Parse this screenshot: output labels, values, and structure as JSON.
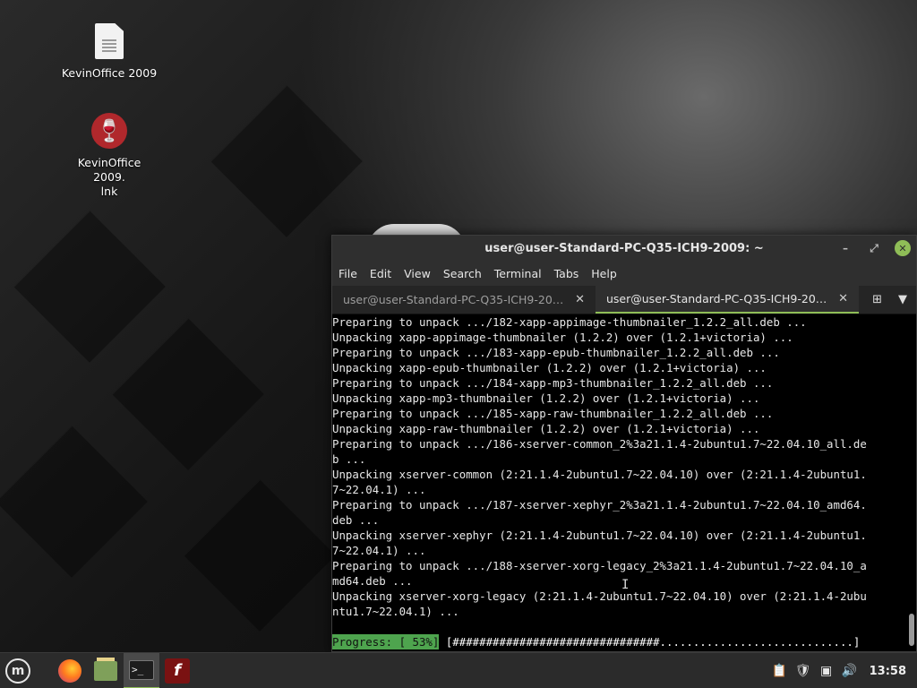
{
  "desktop": {
    "icons": [
      {
        "label": "KevinOffice 2009",
        "icon": "document-icon"
      },
      {
        "label": "KevinOffice 2009.\nlnk",
        "icon": "wine-icon"
      }
    ]
  },
  "terminal": {
    "title": "user@user-Standard-PC-Q35-ICH9-2009: ~",
    "menus": [
      "File",
      "Edit",
      "View",
      "Search",
      "Terminal",
      "Tabs",
      "Help"
    ],
    "tabs": [
      {
        "label": "user@user-Standard-PC-Q35-ICH9-2009: ~",
        "active": false
      },
      {
        "label": "user@user-Standard-PC-Q35-ICH9-2009: ~",
        "active": true
      }
    ],
    "lines": [
      "Preparing to unpack .../182-xapp-appimage-thumbnailer_1.2.2_all.deb ...",
      "Unpacking xapp-appimage-thumbnailer (1.2.2) over (1.2.1+victoria) ...",
      "Preparing to unpack .../183-xapp-epub-thumbnailer_1.2.2_all.deb ...",
      "Unpacking xapp-epub-thumbnailer (1.2.2) over (1.2.1+victoria) ...",
      "Preparing to unpack .../184-xapp-mp3-thumbnailer_1.2.2_all.deb ...",
      "Unpacking xapp-mp3-thumbnailer (1.2.2) over (1.2.1+victoria) ...",
      "Preparing to unpack .../185-xapp-raw-thumbnailer_1.2.2_all.deb ...",
      "Unpacking xapp-raw-thumbnailer (1.2.2) over (1.2.1+victoria) ...",
      "Preparing to unpack .../186-xserver-common_2%3a21.1.4-2ubuntu1.7~22.04.10_all.de",
      "b ...",
      "Unpacking xserver-common (2:21.1.4-2ubuntu1.7~22.04.10) over (2:21.1.4-2ubuntu1.",
      "7~22.04.1) ...",
      "Preparing to unpack .../187-xserver-xephyr_2%3a21.1.4-2ubuntu1.7~22.04.10_amd64.",
      "deb ...",
      "Unpacking xserver-xephyr (2:21.1.4-2ubuntu1.7~22.04.10) over (2:21.1.4-2ubuntu1.",
      "7~22.04.1) ...",
      "Preparing to unpack .../188-xserver-xorg-legacy_2%3a21.1.4-2ubuntu1.7~22.04.10_a",
      "md64.deb ...",
      "Unpacking xserver-xorg-legacy (2:21.1.4-2ubuntu1.7~22.04.10) over (2:21.1.4-2ubu",
      "ntu1.7~22.04.1) ..."
    ],
    "progress_label": "Progress: [ 53%]",
    "progress_bar": " [###############################.............................]",
    "progress_percent": 53
  },
  "taskbar": {
    "launchers": [
      {
        "name": "firefox-icon"
      },
      {
        "name": "files-icon"
      },
      {
        "name": "terminal-icon",
        "active": true
      },
      {
        "name": "flash-player-icon"
      }
    ],
    "tray_icons": [
      "clipboard-icon",
      "shield-icon",
      "network-icon",
      "volume-icon"
    ],
    "clock": "13:58"
  }
}
